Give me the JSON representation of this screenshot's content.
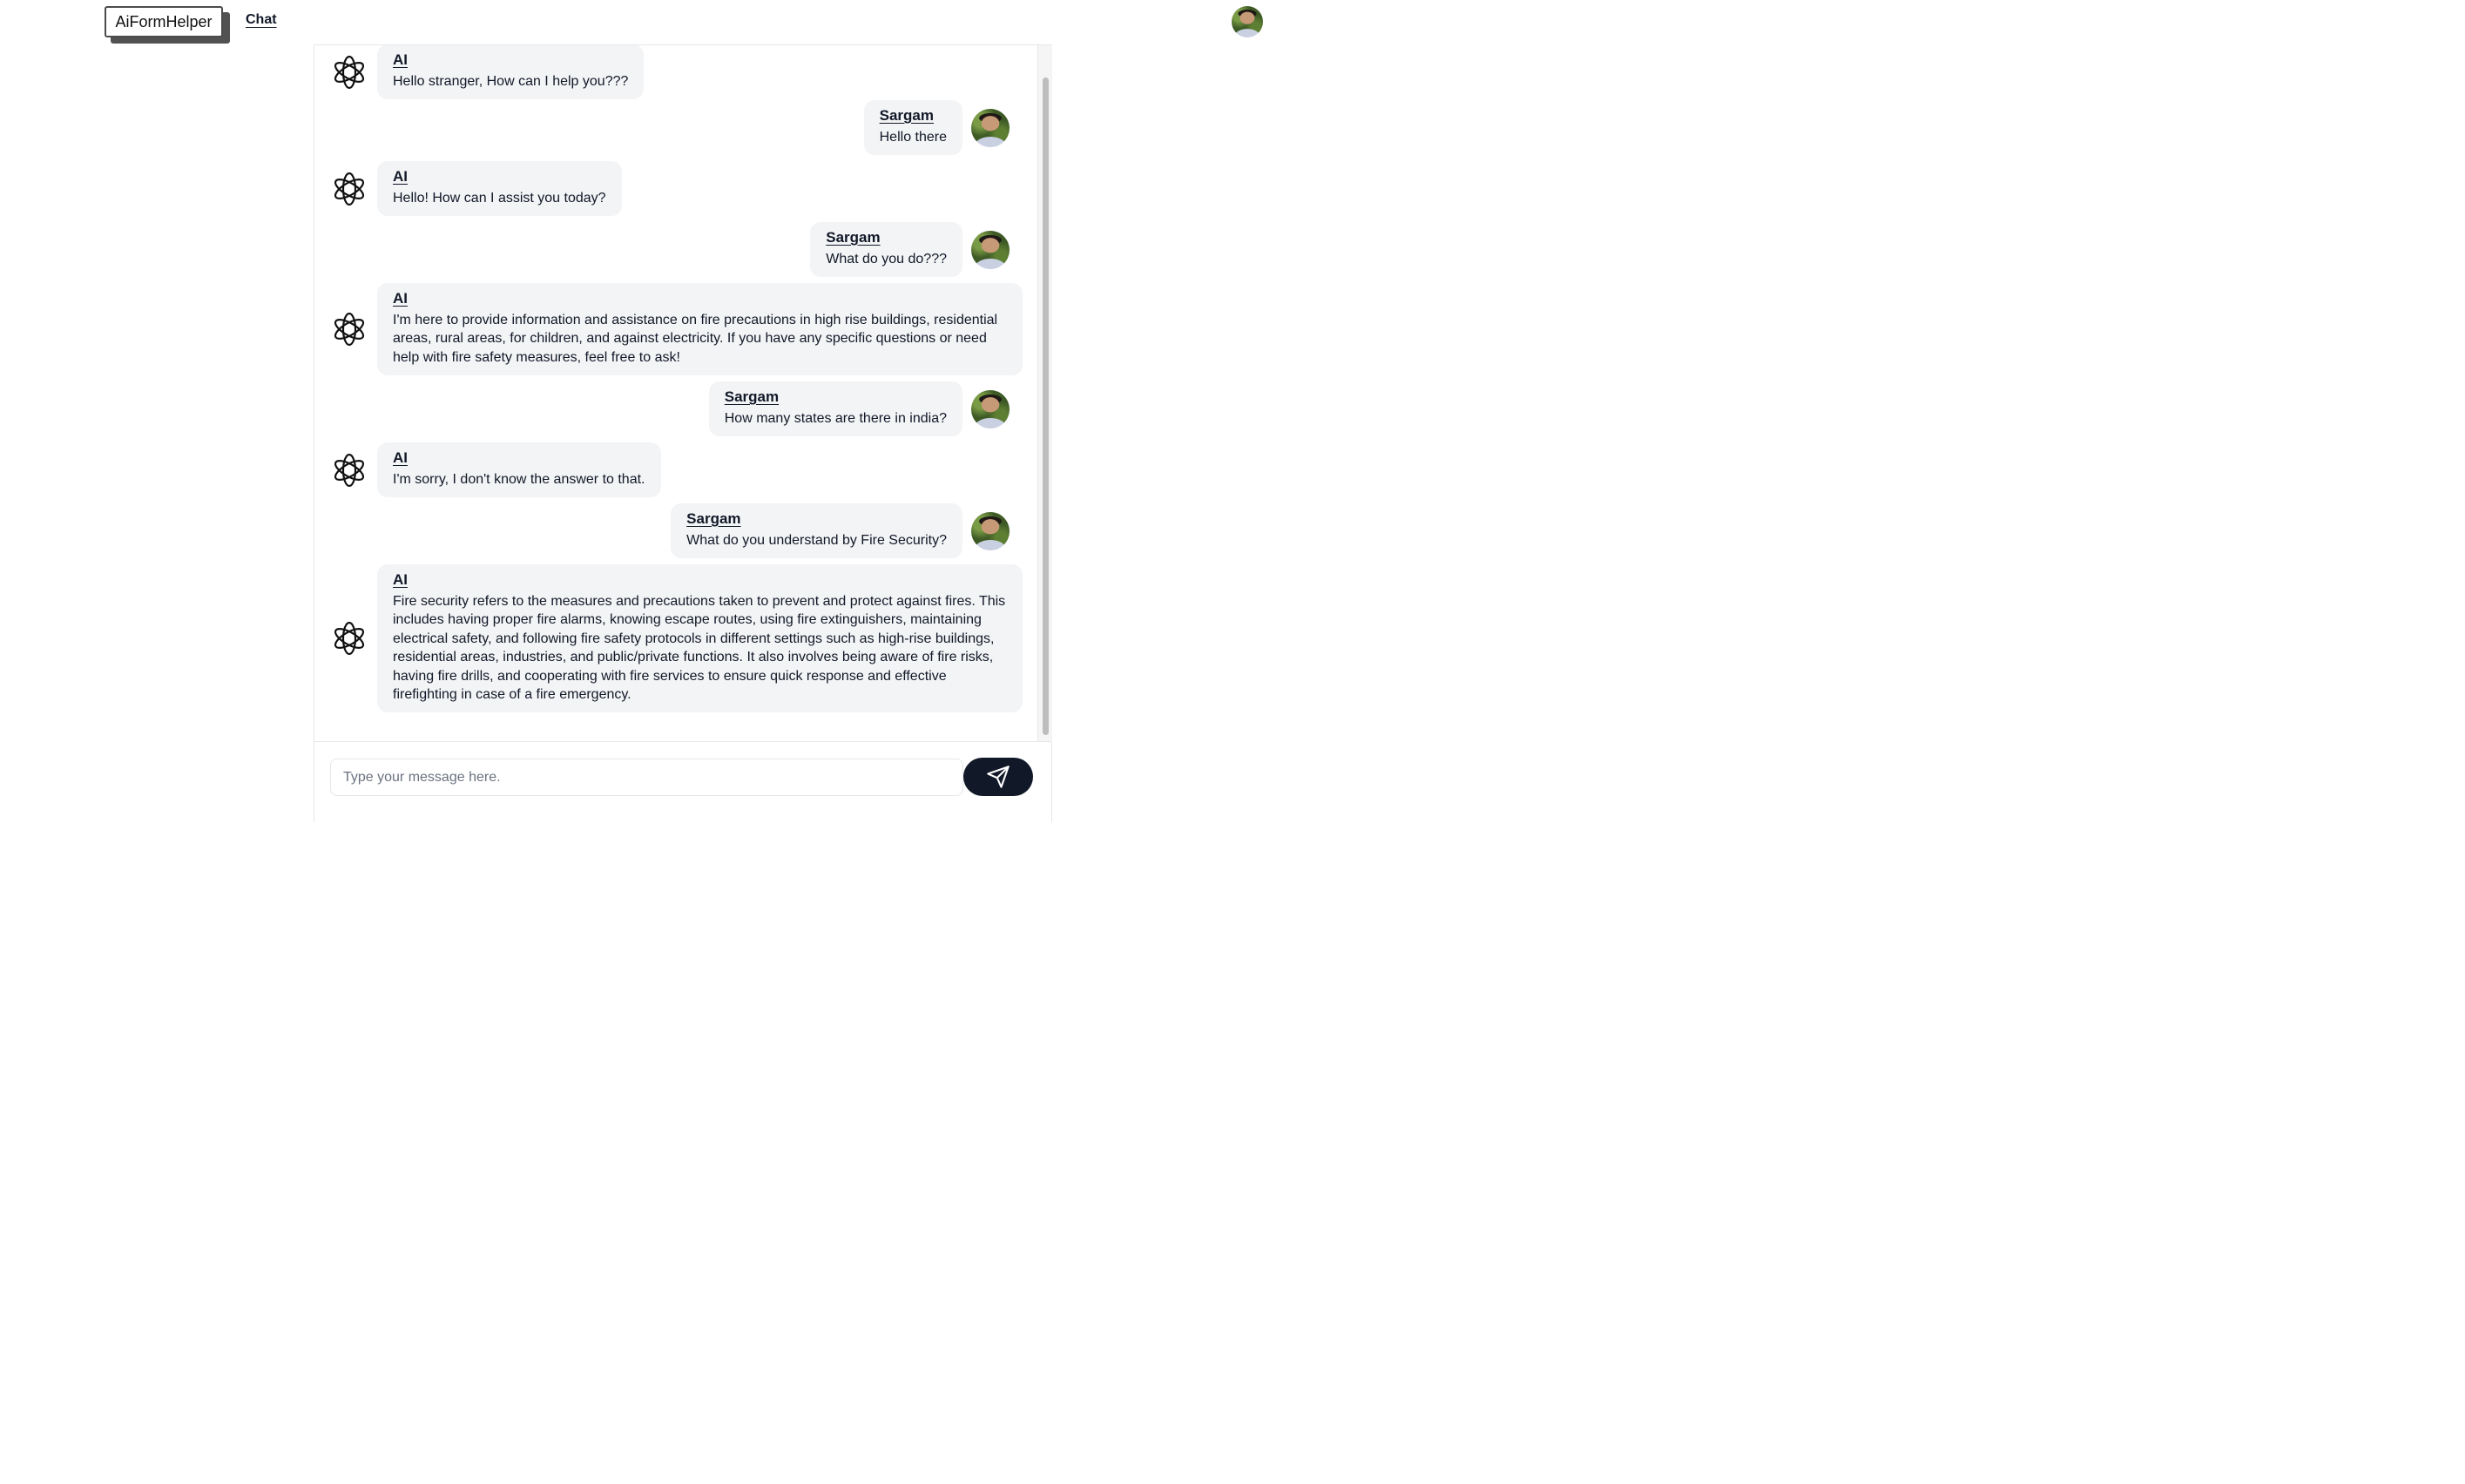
{
  "header": {
    "logo_text": "AiFormHelper",
    "nav_chat": "Chat",
    "avatar_icon": "profile-photo"
  },
  "chat": {
    "messages": [
      {
        "sender": "AI",
        "text": "Hello stranger, How can I help you???"
      },
      {
        "sender": "Sargam",
        "text": "Hello there"
      },
      {
        "sender": "AI",
        "text": "Hello! How can I assist you today?"
      },
      {
        "sender": "Sargam",
        "text": "What do you do???"
      },
      {
        "sender": "AI",
        "text": "I'm here to provide information and assistance on fire precautions in high rise buildings, residential areas, rural areas, for children, and against electricity. If you have any specific questions or need help with fire safety measures, feel free to ask!"
      },
      {
        "sender": "Sargam",
        "text": "How many states are there in india?"
      },
      {
        "sender": "AI",
        "text": "I'm sorry, I don't know the answer to that."
      },
      {
        "sender": "Sargam",
        "text": "What do you understand by Fire Security?"
      },
      {
        "sender": "AI",
        "text": "Fire security refers to the measures and precautions taken to prevent and protect against fires. This includes having proper fire alarms, knowing escape routes, using fire extinguishers, maintaining electrical safety, and following fire safety protocols in different settings such as high-rise buildings, residential areas, industries, and public/private functions. It also involves being aware of fire risks, having fire drills, and cooperating with fire services to ensure quick response and effective firefighting in case of a fire emergency."
      }
    ]
  },
  "composer": {
    "placeholder": "Type your message here.",
    "value": "",
    "send_icon": "paper-plane-icon"
  },
  "colors": {
    "bubble": "#f3f4f6",
    "send_button": "#111827",
    "text": "#111827"
  }
}
